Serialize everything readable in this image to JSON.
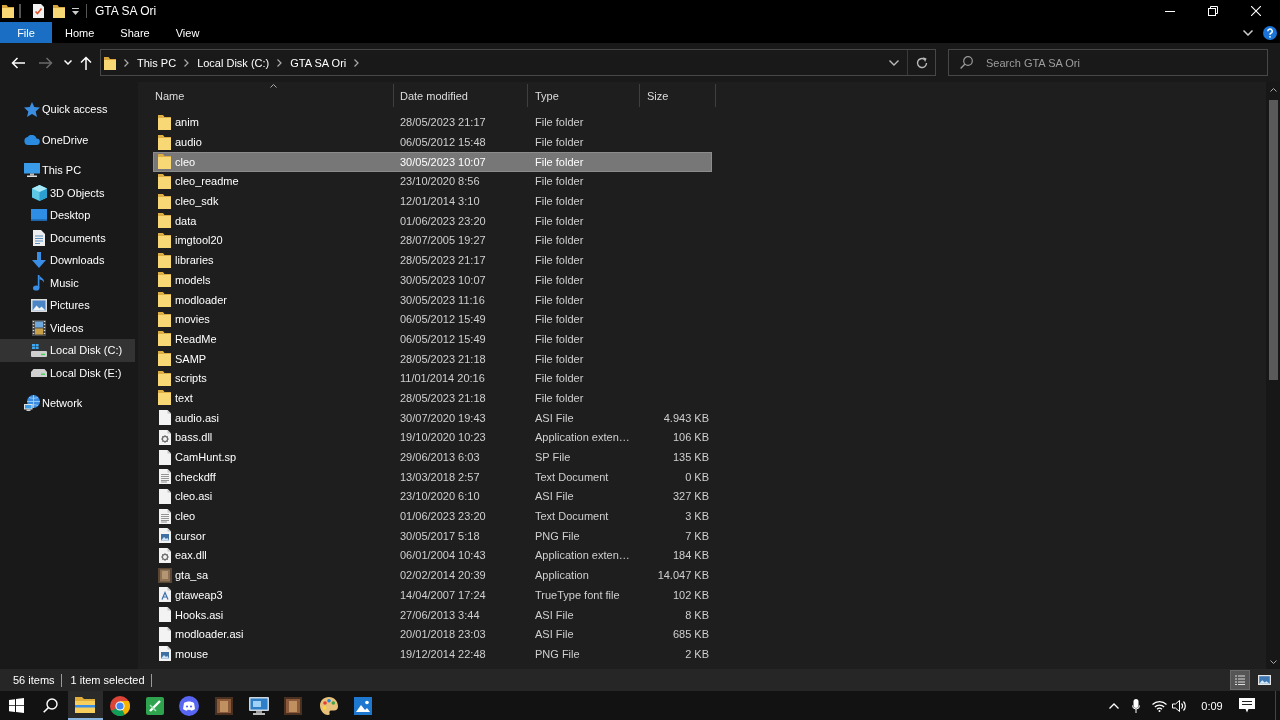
{
  "window": {
    "title": "GTA SA Ori"
  },
  "ribbon": {
    "tabs": [
      {
        "label": "File",
        "kind": "menu"
      },
      {
        "label": "Home",
        "kind": "tab"
      },
      {
        "label": "Share",
        "kind": "tab"
      },
      {
        "label": "View",
        "kind": "tab"
      }
    ]
  },
  "navigation": [
    {
      "kind": "back",
      "disabled": false
    },
    {
      "kind": "forward",
      "disabled": true
    },
    {
      "kind": "recent",
      "disabled": false
    },
    {
      "kind": "up",
      "disabled": false
    }
  ],
  "address_bar": {
    "path": [
      "This PC",
      "Local Disk (C:)",
      "GTA SA Ori"
    ]
  },
  "search": {
    "placeholder": "Search GTA SA Ori"
  },
  "sidebar": {
    "items": [
      {
        "label": "Quick access",
        "kind": "star",
        "selected": false
      },
      {
        "label": "OneDrive",
        "kind": "cloud",
        "selected": false
      },
      {
        "label": "This PC",
        "kind": "computer",
        "selected": false,
        "children": [
          {
            "label": "3D Objects",
            "kind": "cube",
            "selected": false
          },
          {
            "label": "Desktop",
            "kind": "desktop",
            "selected": false
          },
          {
            "label": "Documents",
            "kind": "document",
            "selected": false
          },
          {
            "label": "Downloads",
            "kind": "download",
            "selected": false
          },
          {
            "label": "Music",
            "kind": "music",
            "selected": false
          },
          {
            "label": "Pictures",
            "kind": "picture",
            "selected": false
          },
          {
            "label": "Videos",
            "kind": "video",
            "selected": false
          },
          {
            "label": "Local Disk (C:)",
            "kind": "system_drive",
            "selected": true
          },
          {
            "label": "Local Disk (E:)",
            "kind": "drive",
            "selected": false
          }
        ]
      },
      {
        "label": "Network",
        "kind": "network",
        "selected": false
      }
    ]
  },
  "file_list": {
    "columns": [
      {
        "label": "Name",
        "sorted": true
      },
      {
        "label": "Date modified",
        "sorted": false
      },
      {
        "label": "Type",
        "sorted": false
      },
      {
        "label": "Size",
        "sorted": false
      }
    ],
    "rows": [
      {
        "name": "anim",
        "date": "28/05/2023 21:17",
        "type": "File folder",
        "kind": "folder",
        "selected": false
      },
      {
        "name": "audio",
        "date": "06/05/2012 15:48",
        "type": "File folder",
        "kind": "folder",
        "selected": false
      },
      {
        "name": "cleo",
        "date": "30/05/2023 10:07",
        "type": "File folder",
        "kind": "folder",
        "selected": true
      },
      {
        "name": "cleo_readme",
        "date": "23/10/2020 8:56",
        "type": "File folder",
        "kind": "folder",
        "selected": false
      },
      {
        "name": "cleo_sdk",
        "date": "12/01/2014 3:10",
        "type": "File folder",
        "kind": "folder",
        "selected": false
      },
      {
        "name": "data",
        "date": "01/06/2023 23:20",
        "type": "File folder",
        "kind": "folder",
        "selected": false
      },
      {
        "name": "imgtool20",
        "date": "28/07/2005 19:27",
        "type": "File folder",
        "kind": "folder",
        "selected": false
      },
      {
        "name": "libraries",
        "date": "28/05/2023 21:17",
        "type": "File folder",
        "kind": "folder",
        "selected": false
      },
      {
        "name": "models",
        "date": "30/05/2023 10:07",
        "type": "File folder",
        "kind": "folder",
        "selected": false
      },
      {
        "name": "modloader",
        "date": "30/05/2023 11:16",
        "type": "File folder",
        "kind": "folder",
        "selected": false
      },
      {
        "name": "movies",
        "date": "06/05/2012 15:49",
        "type": "File folder",
        "kind": "folder",
        "selected": false
      },
      {
        "name": "ReadMe",
        "date": "06/05/2012 15:49",
        "type": "File folder",
        "kind": "folder",
        "selected": false
      },
      {
        "name": "SAMP",
        "date": "28/05/2023 21:18",
        "type": "File folder",
        "kind": "folder",
        "selected": false
      },
      {
        "name": "scripts",
        "date": "11/01/2014 20:16",
        "type": "File folder",
        "kind": "folder",
        "selected": false
      },
      {
        "name": "text",
        "date": "28/05/2023 21:18",
        "type": "File folder",
        "kind": "folder",
        "selected": false
      },
      {
        "name": "audio.asi",
        "date": "30/07/2020 19:43",
        "type": "ASI File",
        "size": "4.943 KB",
        "kind": "file",
        "selected": false
      },
      {
        "name": "bass.dll",
        "date": "19/10/2020 10:23",
        "type": "Application exten…",
        "size": "106 KB",
        "kind": "extension",
        "selected": false
      },
      {
        "name": "CamHunt.sp",
        "date": "29/06/2013 6:03",
        "type": "SP File",
        "size": "135 KB",
        "kind": "file",
        "selected": false
      },
      {
        "name": "checkdff",
        "date": "13/03/2018 2:57",
        "type": "Text Document",
        "size": "0 KB",
        "kind": "text",
        "selected": false
      },
      {
        "name": "cleo.asi",
        "date": "23/10/2020 6:10",
        "type": "ASI File",
        "size": "327 KB",
        "kind": "file",
        "selected": false
      },
      {
        "name": "cleo",
        "date": "01/06/2023 23:20",
        "type": "Text Document",
        "size": "3 KB",
        "kind": "text",
        "selected": false
      },
      {
        "name": "cursor",
        "date": "30/05/2017 5:18",
        "type": "PNG File",
        "size": "7 KB",
        "kind": "image",
        "selected": false
      },
      {
        "name": "eax.dll",
        "date": "06/01/2004 10:43",
        "type": "Application exten…",
        "size": "184 KB",
        "kind": "extension",
        "selected": false
      },
      {
        "name": "gta_sa",
        "date": "02/02/2014 20:39",
        "type": "Application",
        "size": "14.047 KB",
        "kind": "application",
        "selected": false
      },
      {
        "name": "gtaweap3",
        "date": "14/04/2007 17:24",
        "type": "TrueType font file",
        "size": "102 KB",
        "kind": "font",
        "selected": false
      },
      {
        "name": "Hooks.asi",
        "date": "27/06/2013 3:44",
        "type": "ASI File",
        "size": "8 KB",
        "kind": "file",
        "selected": false
      },
      {
        "name": "modloader.asi",
        "date": "20/01/2018 23:03",
        "type": "ASI File",
        "size": "685 KB",
        "kind": "file",
        "selected": false
      },
      {
        "name": "mouse",
        "date": "19/12/2014 22:48",
        "type": "PNG File",
        "size": "2 KB",
        "kind": "image",
        "selected": false
      }
    ]
  },
  "status_bar": {
    "item_count": "56 items",
    "selection": "1 item selected",
    "views": [
      {
        "kind": "details",
        "selected": true
      },
      {
        "kind": "large_icons",
        "selected": false
      }
    ]
  },
  "taskbar": {
    "apps": [
      {
        "kind": "folder",
        "active": true
      },
      {
        "kind": "browser",
        "active": false
      },
      {
        "kind": "pen_tile",
        "active": false
      },
      {
        "kind": "chat",
        "active": false
      },
      {
        "kind": "game",
        "active": false
      },
      {
        "kind": "remote",
        "active": false
      },
      {
        "kind": "game",
        "active": false
      },
      {
        "kind": "paint",
        "active": false
      },
      {
        "kind": "photos",
        "active": false
      }
    ],
    "clock": "0:09"
  }
}
